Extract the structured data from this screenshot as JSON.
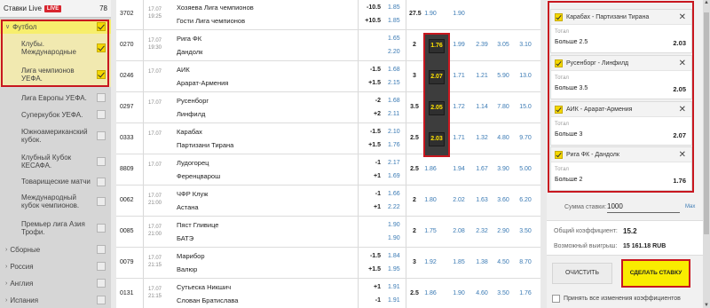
{
  "sidebar": {
    "title": "Ставки Live",
    "live_badge": "LIVE",
    "count": "78",
    "items": [
      {
        "label": "Футбол",
        "caret": "∨",
        "checked": true,
        "style": "yellow"
      },
      {
        "label": "Клубы. Международные",
        "checked": true,
        "style": "sel"
      },
      {
        "label": "Лига чемпионов УЕФА.",
        "checked": true,
        "style": "sel"
      },
      {
        "label": "Лига Европы УЕФА.",
        "checked": false
      },
      {
        "label": "Суперкубок УЕФА.",
        "checked": false
      },
      {
        "label": "Южноамериканский кубок.",
        "checked": false
      },
      {
        "label": "Клубный Кубок КЕСАФА.",
        "checked": false
      },
      {
        "label": "Товарищеские матчи",
        "checked": false
      },
      {
        "label": "Международный кубок чемпионов.",
        "checked": false
      },
      {
        "label": "Премьер лига Азия Трофи.",
        "checked": false
      },
      {
        "label": "Сборные",
        "caret": "›",
        "checked": false
      },
      {
        "label": "Россия",
        "caret": "›",
        "checked": false
      },
      {
        "label": "Англия",
        "caret": "›",
        "checked": false
      },
      {
        "label": "Испания",
        "caret": "›",
        "checked": false
      }
    ]
  },
  "matches": [
    {
      "id": "3702",
      "date": "17.07",
      "time": "19:25",
      "team1": "Хозяева Лига чемпионов",
      "team2": "Гости Лига чемпионов",
      "h1": "-10.5",
      "h2": "+10.5",
      "ho1": "1.85",
      "ho2": "1.85",
      "total": "27.5",
      "odds": [
        "1.90",
        "1.90",
        "",
        "",
        ""
      ]
    },
    {
      "id": "0270",
      "date": "17.07",
      "time": "19:30",
      "team1": "Рига ФК",
      "team2": "Дандолк",
      "h1": "",
      "h2": "",
      "ho1": "1.65",
      "ho2": "2.20",
      "total": "2",
      "odds": [
        "1.76",
        "1.99",
        "2.39",
        "3.05",
        "3.10"
      ]
    },
    {
      "id": "0246",
      "date": "17.07",
      "time": "",
      "team1": "АИК",
      "team2": "Арарат-Армения",
      "h1": "-1.5",
      "h2": "+1.5",
      "ho1": "1.68",
      "ho2": "2.15",
      "total": "3",
      "odds": [
        "2.07",
        "1.71",
        "1.21",
        "5.90",
        "13.0"
      ]
    },
    {
      "id": "0297",
      "date": "17.07",
      "time": "",
      "team1": "Русенборг",
      "team2": "Линфилд",
      "h1": "-2",
      "h2": "+2",
      "ho1": "1.68",
      "ho2": "2.11",
      "total": "3.5",
      "odds": [
        "2.05",
        "1.72",
        "1.14",
        "7.80",
        "15.0"
      ]
    },
    {
      "id": "0333",
      "date": "17.07",
      "time": "",
      "team1": "Карабах",
      "team2": "Партизани Тирана",
      "h1": "-1.5",
      "h2": "+1.5",
      "ho1": "2.10",
      "ho2": "1.76",
      "total": "2.5",
      "odds": [
        "2.03",
        "1.71",
        "1.32",
        "4.80",
        "9.70"
      ]
    },
    {
      "id": "8809",
      "date": "17.07",
      "time": "",
      "team1": "Лудогорец",
      "team2": "Ференцварош",
      "h1": "-1",
      "h2": "+1",
      "ho1": "2.17",
      "ho2": "1.69",
      "total": "2.5",
      "odds": [
        "1.86",
        "1.94",
        "1.67",
        "3.90",
        "5.00"
      ]
    },
    {
      "id": "0062",
      "date": "17.07",
      "time": "21:00",
      "team1": "ЧФР Клуж",
      "team2": "Астана",
      "h1": "-1",
      "h2": "+1",
      "ho1": "1.66",
      "ho2": "2.22",
      "total": "2",
      "odds": [
        "1.80",
        "2.02",
        "1.63",
        "3.60",
        "6.20"
      ]
    },
    {
      "id": "0085",
      "date": "17.07",
      "time": "21:00",
      "team1": "Пяст Гливице",
      "team2": "БАТЭ",
      "h1": "",
      "h2": "",
      "ho1": "1.90",
      "ho2": "1.90",
      "total": "2",
      "odds": [
        "1.75",
        "2.08",
        "2.32",
        "2.90",
        "3.50"
      ]
    },
    {
      "id": "0079",
      "date": "17.07",
      "time": "21:15",
      "team1": "Марибор",
      "team2": "Валюр",
      "h1": "-1.5",
      "h2": "+1.5",
      "ho1": "1.84",
      "ho2": "1.95",
      "total": "3",
      "odds": [
        "1.92",
        "1.85",
        "1.38",
        "4.50",
        "8.70"
      ]
    },
    {
      "id": "0131",
      "date": "17.07",
      "time": "21:15",
      "team1": "Сутьеска Никшич",
      "team2": "Слован Братислава",
      "h1": "+1",
      "h2": "-1",
      "ho1": "1.91",
      "ho2": "1.91",
      "total": "2.5",
      "odds": [
        "1.86",
        "1.90",
        "4.60",
        "3.50",
        "1.76"
      ]
    }
  ],
  "betslip": {
    "bets": [
      {
        "match": "Карабах - Партизани Тирана",
        "sub": "Тотал",
        "market": "Больше 2.5",
        "odd": "2.03"
      },
      {
        "match": "Русенборг - Линфилд",
        "sub": "Тотал",
        "market": "Больше 3.5",
        "odd": "2.05"
      },
      {
        "match": "АИК - Арарат-Армения",
        "sub": "Тотал",
        "market": "Больше 3",
        "odd": "2.07"
      },
      {
        "match": "Рига ФК - Дандолк",
        "sub": "Тотал",
        "market": "Больше 2",
        "odd": "1.76"
      }
    ],
    "close_icon": "✕",
    "stake_label": "Сумма ставки:",
    "stake_value": "1000",
    "stake_max": "Max",
    "total_coef_label": "Общий коэффициент:",
    "total_coef": "15.2",
    "win_label": "Возможный выигрыш:",
    "win_value": "15 161.18 RUB",
    "clear_button": "ОЧИСТИТЬ",
    "bet_button": "СДЕЛАТЬ СТАВКУ",
    "accept_text": "Принять все изменения коэффициентов"
  },
  "colors": {
    "accent_yellow": "#f9ec00",
    "highlight_red": "#c8171f",
    "odds_blue": "#3a7ab4",
    "live_red": "#d8262f"
  }
}
